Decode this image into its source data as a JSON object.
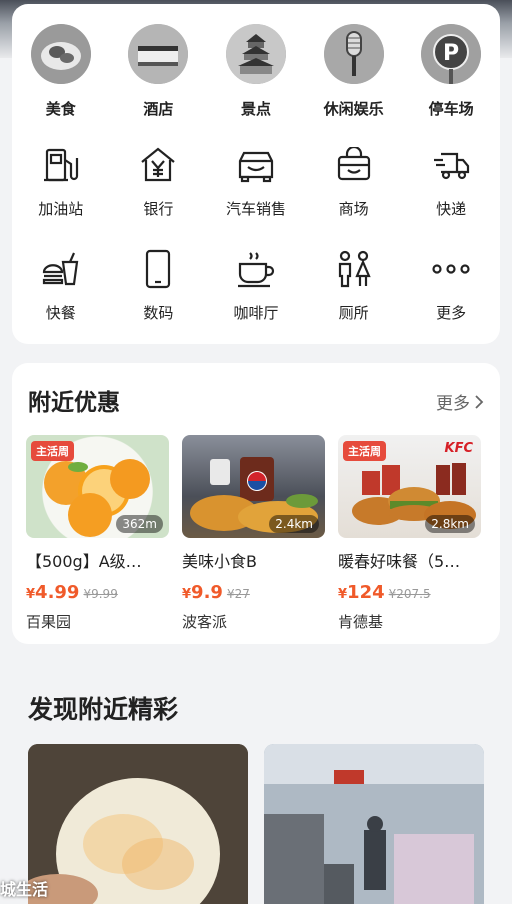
{
  "categories_row1": [
    {
      "label": "美食",
      "icon": "food-plate-icon"
    },
    {
      "label": "酒店",
      "icon": "hotel-bed-icon"
    },
    {
      "label": "景点",
      "icon": "temple-landmark-icon"
    },
    {
      "label": "休闲娱乐",
      "icon": "microphone-icon"
    },
    {
      "label": "停车场",
      "icon": "parking-sign-icon"
    }
  ],
  "categories_row2": [
    {
      "label": "加油站",
      "icon": "gas-pump-icon"
    },
    {
      "label": "银行",
      "icon": "bank-yen-icon"
    },
    {
      "label": "汽车销售",
      "icon": "car-icon"
    },
    {
      "label": "商场",
      "icon": "shopping-basket-icon"
    },
    {
      "label": "快递",
      "icon": "delivery-truck-icon"
    }
  ],
  "categories_row3": [
    {
      "label": "快餐",
      "icon": "burger-drink-icon"
    },
    {
      "label": "数码",
      "icon": "smartphone-icon"
    },
    {
      "label": "咖啡厅",
      "icon": "coffee-cup-icon"
    },
    {
      "label": "厕所",
      "icon": "restroom-icon"
    },
    {
      "label": "更多",
      "icon": "more-dots-icon"
    }
  ],
  "deals_section": {
    "title": "附近优惠",
    "more_label": "更多",
    "items": [
      {
        "name": "【500g】A级…",
        "price_symbol": "¥",
        "price": "4.99",
        "original": "¥9.99",
        "shop": "百果园",
        "distance": "362m",
        "tag": "主活周"
      },
      {
        "name": "美味小食B",
        "price_symbol": "¥",
        "price": "9.9",
        "original": "¥27",
        "shop": "波客派",
        "distance": "2.4km",
        "tag": ""
      },
      {
        "name": "暖春好味餐（5…",
        "price_symbol": "¥",
        "price": "124",
        "original": "¥207.5",
        "shop": "肯德基",
        "distance": "2.8km",
        "tag": "主活周",
        "brand": "KFC"
      }
    ]
  },
  "discover_section": {
    "title": "发现附近精彩"
  },
  "watermark": "城生活",
  "colors": {
    "accent_price": "#f05a2a",
    "tag_red": "#e64b3c",
    "kfc_red": "#d61f26"
  }
}
